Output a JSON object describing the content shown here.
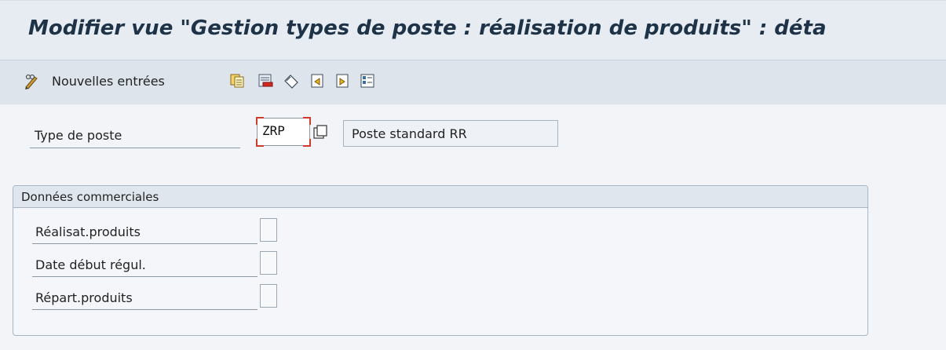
{
  "title": "Modifier vue \"Gestion types de poste : réalisation de produits\" : déta",
  "toolbar": {
    "new_entries_label": "Nouvelles entrées",
    "icons": [
      "pen-glasses-icon",
      "copy-icon",
      "delete-icon",
      "undo-icon",
      "previous-entry-icon",
      "next-entry-icon",
      "select-all-icon"
    ]
  },
  "form": {
    "type_label": "Type de poste",
    "type_value": "ZRP",
    "type_description": "Poste standard RR"
  },
  "group": {
    "title": "Données commerciales",
    "rows": [
      {
        "label": "Réalisat.produits",
        "checked": false
      },
      {
        "label": "Date début régul.",
        "checked": false
      },
      {
        "label": "Répart.produits",
        "checked": false
      }
    ]
  }
}
